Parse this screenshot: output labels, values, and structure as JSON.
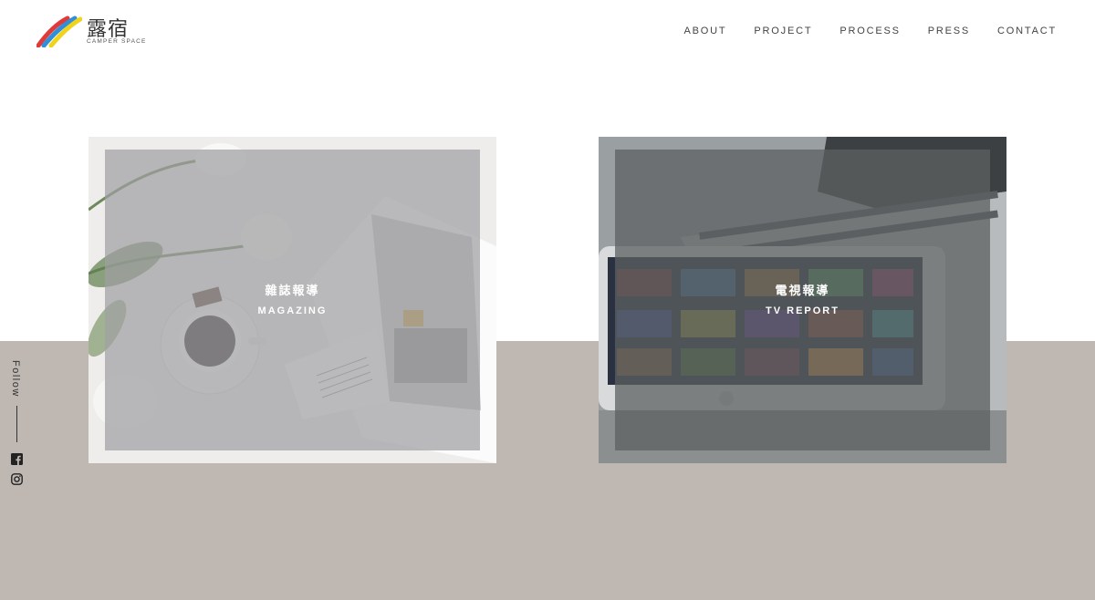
{
  "header": {
    "logo_cjk": "露宿",
    "logo_sub": "CAMPER SPACE",
    "nav": [
      {
        "label": "ABOUT"
      },
      {
        "label": "PROJECT"
      },
      {
        "label": "PROCESS"
      },
      {
        "label": "PRESS"
      },
      {
        "label": "CONTACT"
      }
    ]
  },
  "cards": [
    {
      "title_cjk": "雜誌報導",
      "title_en": "MAGAZING"
    },
    {
      "title_cjk": "電視報導",
      "title_en": "TV REPORT"
    }
  ],
  "side": {
    "follow_label": "Follow",
    "icons": [
      "facebook-icon",
      "instagram-icon"
    ]
  },
  "colors": {
    "band": "#bfb8b2",
    "text_dark": "#444444",
    "logo_blue": "#2f8fd8",
    "logo_yellow": "#f2d31b",
    "logo_red": "#e03b3b"
  }
}
